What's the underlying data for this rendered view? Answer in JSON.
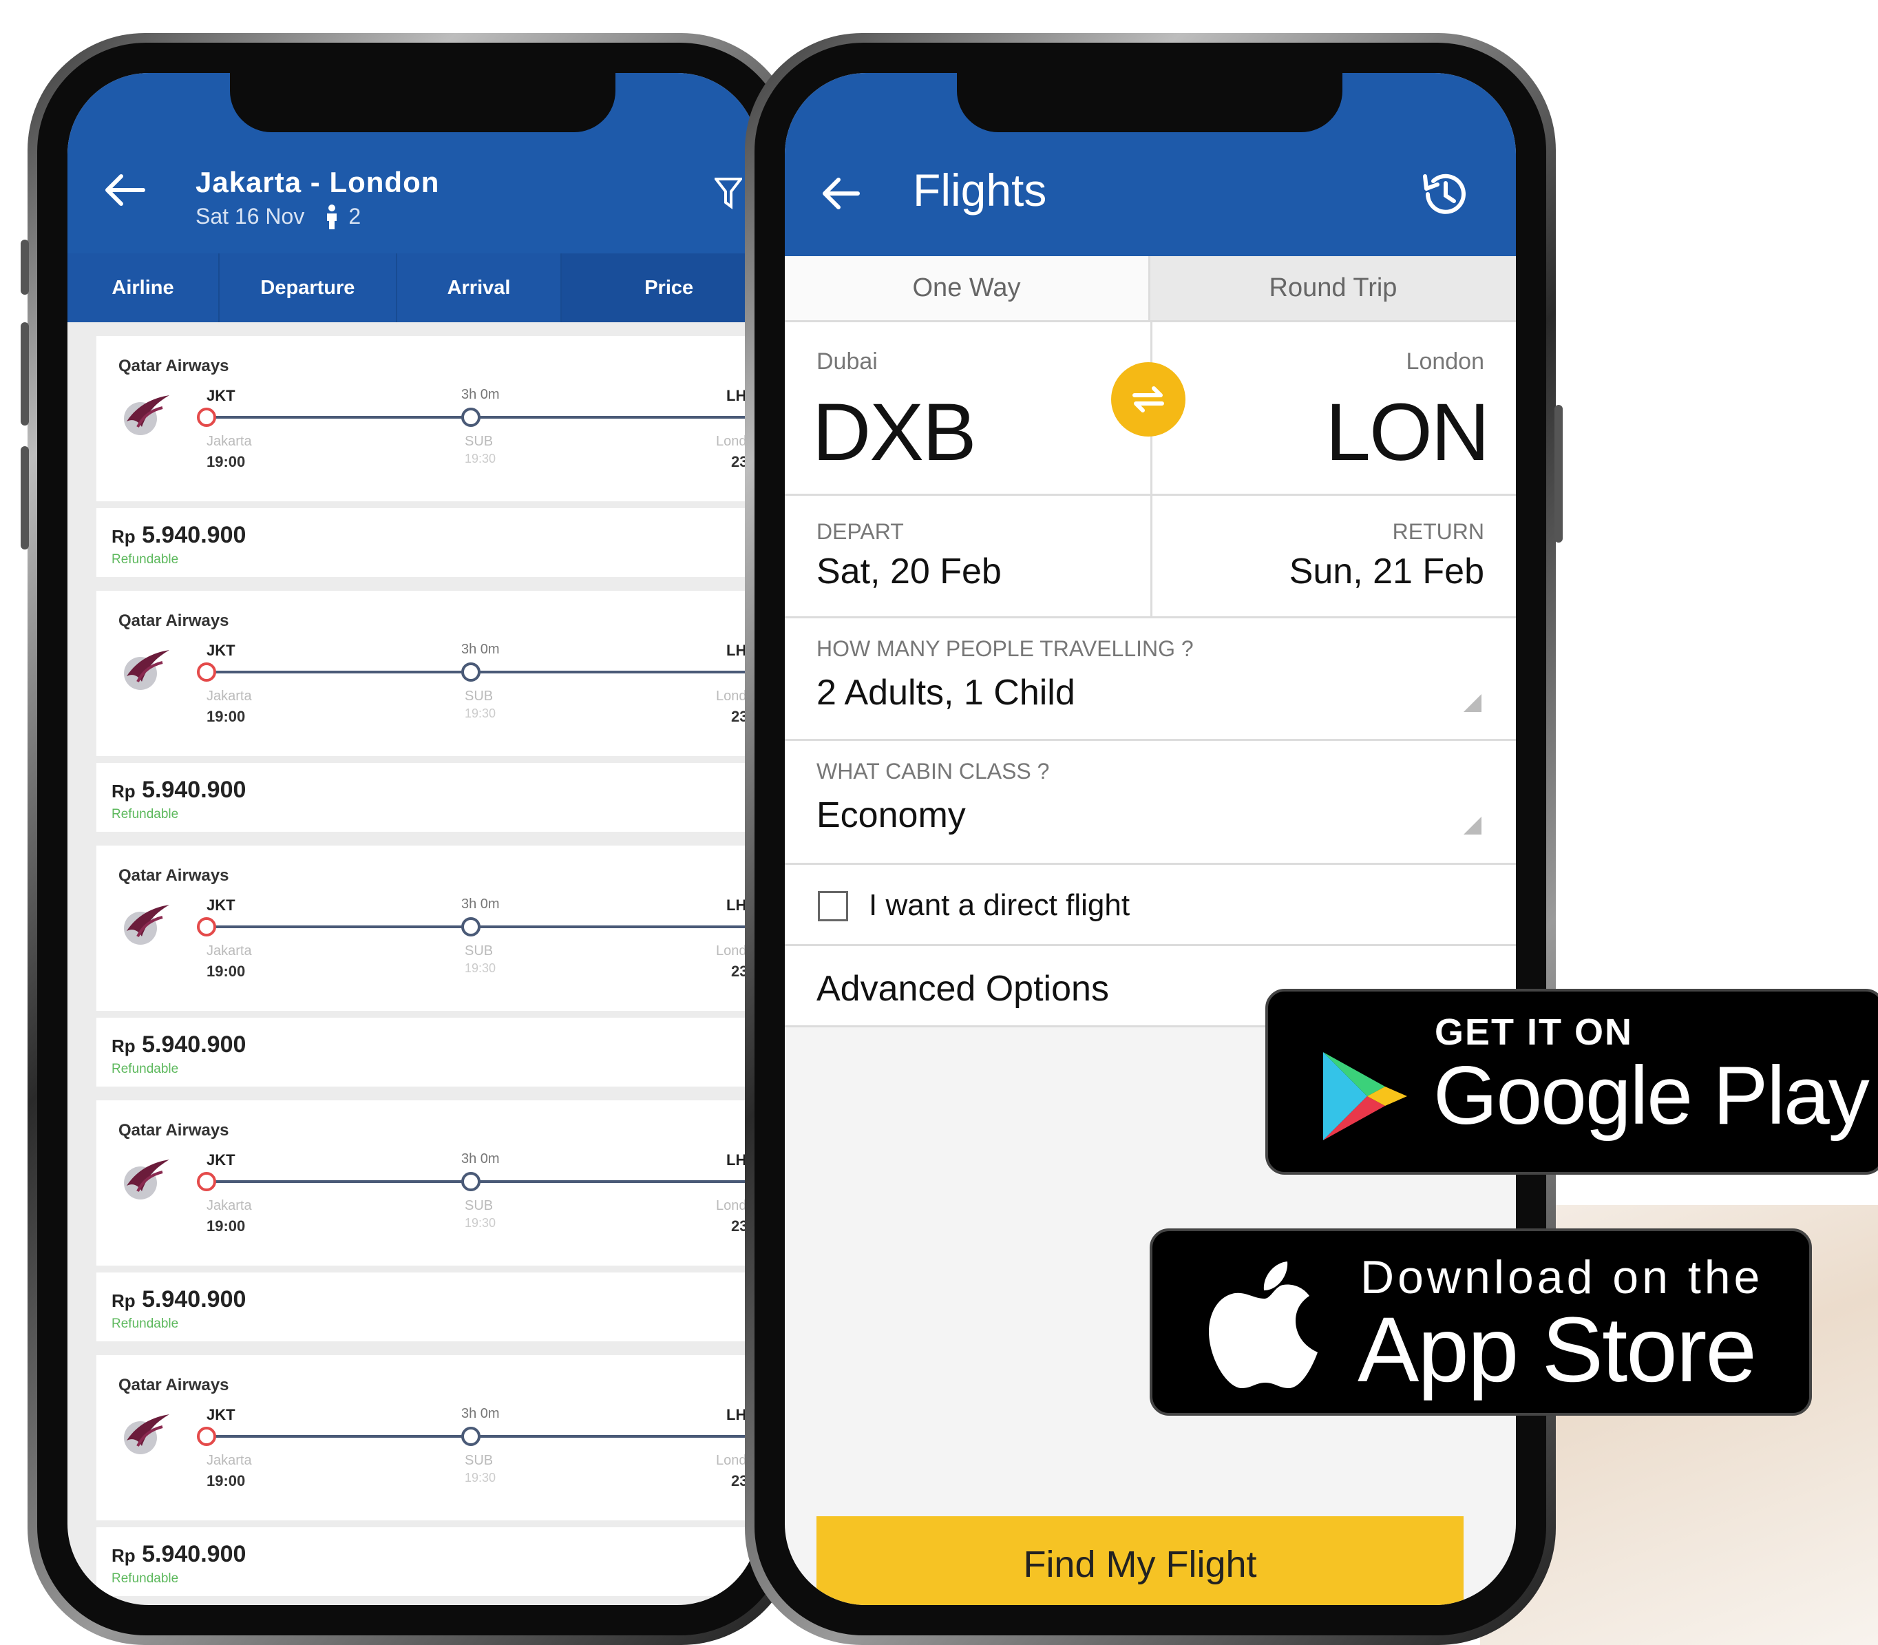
{
  "left_app": {
    "header": {
      "title": "Jakarta - London",
      "date": "Sat 16 Nov",
      "passengers": "2"
    },
    "sort_tabs": [
      "Airline",
      "Departure",
      "Arrival",
      "Price"
    ],
    "results": [
      {
        "airline": "Qatar Airways",
        "from_code": "JKT",
        "to_code": "LH",
        "duration": "3h 0m",
        "from_city": "Jakarta",
        "from_time": "19:00",
        "stop_code": "SUB",
        "stop_time": "19:30",
        "to_city": "Lond",
        "to_time": "23:",
        "price_currency": "Rp",
        "price": "5.940.900",
        "fare_note": "Refundable"
      },
      {
        "airline": "Qatar Airways",
        "from_code": "JKT",
        "to_code": "LH",
        "duration": "3h 0m",
        "from_city": "Jakarta",
        "from_time": "19:00",
        "stop_code": "SUB",
        "stop_time": "19:30",
        "to_city": "Lond",
        "to_time": "23:",
        "price_currency": "Rp",
        "price": "5.940.900",
        "fare_note": "Refundable"
      },
      {
        "airline": "Qatar Airways",
        "from_code": "JKT",
        "to_code": "LH",
        "duration": "3h 0m",
        "from_city": "Jakarta",
        "from_time": "19:00",
        "stop_code": "SUB",
        "stop_time": "19:30",
        "to_city": "Lond",
        "to_time": "23:",
        "price_currency": "Rp",
        "price": "5.940.900",
        "fare_note": "Refundable"
      },
      {
        "airline": "Qatar Airways",
        "from_code": "JKT",
        "to_code": "LH",
        "duration": "3h 0m",
        "from_city": "Jakarta",
        "from_time": "19:00",
        "stop_code": "SUB",
        "stop_time": "19:30",
        "to_city": "Lond",
        "to_time": "23:",
        "price_currency": "Rp",
        "price": "5.940.900",
        "fare_note": "Refundable"
      },
      {
        "airline": "Qatar Airways",
        "from_code": "JKT",
        "to_code": "LH",
        "duration": "3h 0m",
        "from_city": "Jakarta",
        "from_time": "19:00",
        "stop_code": "SUB",
        "stop_time": "19:30",
        "to_city": "Lond",
        "to_time": "23:",
        "price_currency": "Rp",
        "price": "5.940.900",
        "fare_note": "Refundable"
      }
    ]
  },
  "right_app": {
    "header": {
      "title": "Flights"
    },
    "trip_tabs": {
      "one_way": "One Way",
      "round_trip": "Round Trip"
    },
    "origin": {
      "city": "Dubai",
      "code": "DXB"
    },
    "destination": {
      "city": "London",
      "code": "LON"
    },
    "depart": {
      "label": "DEPART",
      "value": "Sat, 20 Feb"
    },
    "return": {
      "label": "RETURN",
      "value": "Sun, 21 Feb"
    },
    "travellers": {
      "label": "HOW MANY PEOPLE TRAVELLING ?",
      "value": "2 Adults, 1 Child"
    },
    "cabin": {
      "label": "WHAT CABIN CLASS ?",
      "value": "Economy"
    },
    "direct_flight": {
      "label": "I want a direct flight",
      "checked": false
    },
    "advanced": "Advanced Options",
    "submit": "Find My Flight"
  },
  "badges": {
    "google_play": {
      "top": "GET IT ON",
      "main": "Google Play"
    },
    "app_store": {
      "top": "Download on the",
      "main": "App Store"
    }
  },
  "colors": {
    "header_blue": "#1e5aaa",
    "accent_yellow": "#f6c324",
    "refundable_green": "#5cb85c",
    "route_red": "#e44a4a"
  },
  "icons": [
    "back-arrow-icon",
    "filter-icon",
    "person-icon",
    "history-icon",
    "swap-icon",
    "qatar-logo-icon",
    "google-play-icon",
    "apple-icon"
  ]
}
